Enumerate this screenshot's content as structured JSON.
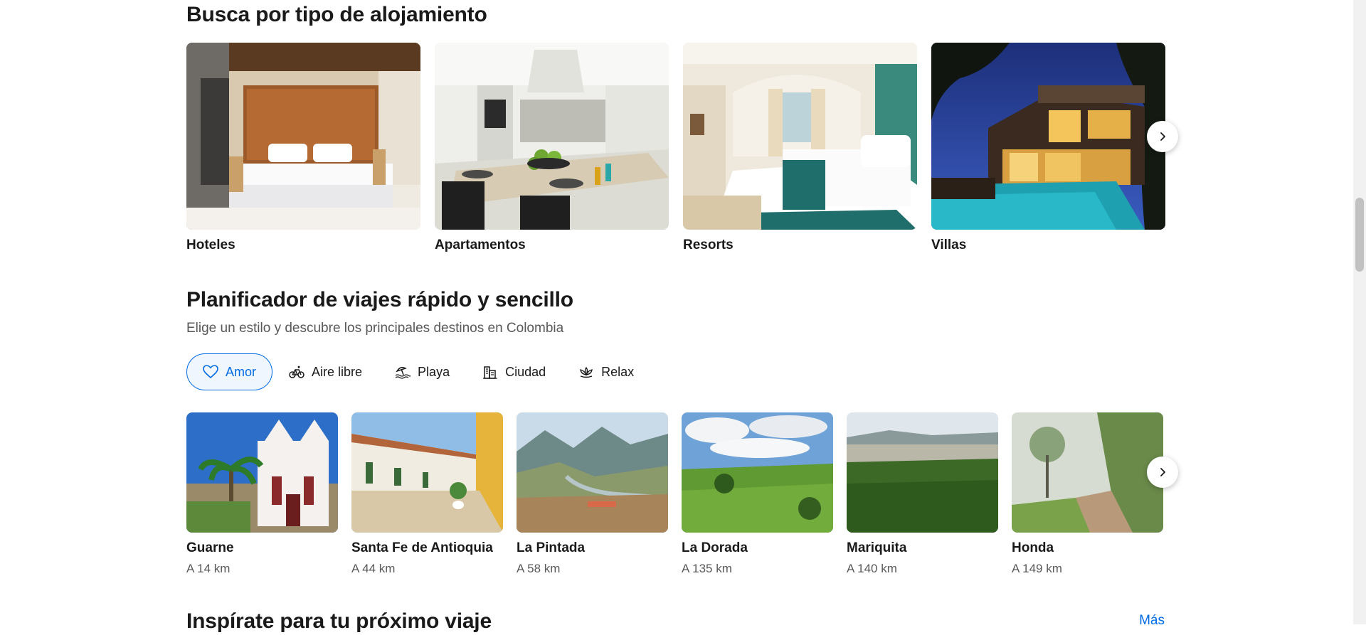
{
  "section_types": {
    "title": "Busca por tipo de alojamiento",
    "cards": [
      {
        "label": "Hoteles",
        "image": "hotel-room-photo"
      },
      {
        "label": "Apartamentos",
        "image": "apartment-kitchen-photo"
      },
      {
        "label": "Resorts",
        "image": "resort-room-photo"
      },
      {
        "label": "Villas",
        "image": "villa-pool-night-photo"
      }
    ]
  },
  "section_planner": {
    "title": "Planificador de viajes rápido y sencillo",
    "subtitle": "Elige un estilo y descubre los principales destinos en Colombia",
    "tabs": [
      {
        "label": "Amor",
        "icon": "heart-icon",
        "active": true
      },
      {
        "label": "Aire libre",
        "icon": "bicycle-icon",
        "active": false
      },
      {
        "label": "Playa",
        "icon": "beach-icon",
        "active": false
      },
      {
        "label": "Ciudad",
        "icon": "city-icon",
        "active": false
      },
      {
        "label": "Relax",
        "icon": "lotus-icon",
        "active": false
      }
    ],
    "destinations": [
      {
        "name": "Guarne",
        "distance": "A 14 km"
      },
      {
        "name": "Santa Fe de Antioquia",
        "distance": "A 44 km"
      },
      {
        "name": "La Pintada",
        "distance": "A 58 km"
      },
      {
        "name": "La Dorada",
        "distance": "A 135 km"
      },
      {
        "name": "Mariquita",
        "distance": "A 140 km"
      },
      {
        "name": "Honda",
        "distance": "A 149 km"
      }
    ]
  },
  "section_inspire": {
    "title": "Inspírate para tu próximo viaje",
    "more_label": "Más"
  },
  "colors": {
    "accent": "#006ce4",
    "text": "#1a1a1a",
    "muted": "#595959"
  }
}
